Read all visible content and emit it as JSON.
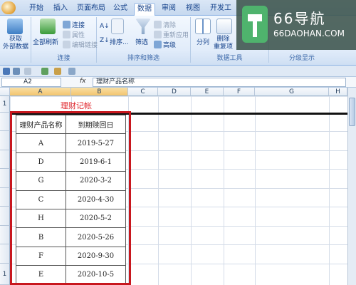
{
  "tabs": [
    "开始",
    "插入",
    "页面布局",
    "公式",
    "数据",
    "审阅",
    "视图",
    "开发工"
  ],
  "active_tab": "数据",
  "ribbon": {
    "get_external": "获取\n外部数据",
    "refresh_all": "全部刷新",
    "connections": "连接",
    "properties": "属性",
    "edit_links": "编辑链接",
    "group_connections": "连接",
    "sort_az": "A↓Z",
    "sort": "排序...",
    "filter": "筛选",
    "clear": "清除",
    "reapply": "重新应用",
    "advanced": "高级",
    "group_sort_filter": "排序和筛选",
    "text_to_columns": "分列",
    "remove_duplicates": "删除\n重复项",
    "group_data_tools": "数据工具",
    "group_outline": "分级显示"
  },
  "formula_bar": {
    "name_box": "A2",
    "fx": "fx",
    "content": "理财产品名称"
  },
  "columns": [
    "A",
    "B",
    "C",
    "D",
    "E",
    "F",
    "G",
    "H"
  ],
  "row_numbers": [
    "1",
    "",
    "",
    "",
    "",
    "",
    "",
    "",
    "",
    "1"
  ],
  "sheet": {
    "title": "理财记帐",
    "headers": [
      "理财产品名称",
      "到期赎回日"
    ],
    "rows": [
      [
        "A",
        "2019-5-27"
      ],
      [
        "D",
        "2019-6-1"
      ],
      [
        "G",
        "2020-3-2"
      ],
      [
        "C",
        "2020-4-30"
      ],
      [
        "H",
        "2020-5-2"
      ],
      [
        "B",
        "2020-5-26"
      ],
      [
        "F",
        "2020-9-30"
      ],
      [
        "E",
        "2020-10-5"
      ]
    ]
  },
  "watermark": {
    "name": "66导航",
    "url": "66DAOHAN.COM"
  },
  "colors": {
    "title_red": "#e0242a",
    "highlight_box": "#c8171e",
    "ribbon_blue": "#15428b"
  }
}
